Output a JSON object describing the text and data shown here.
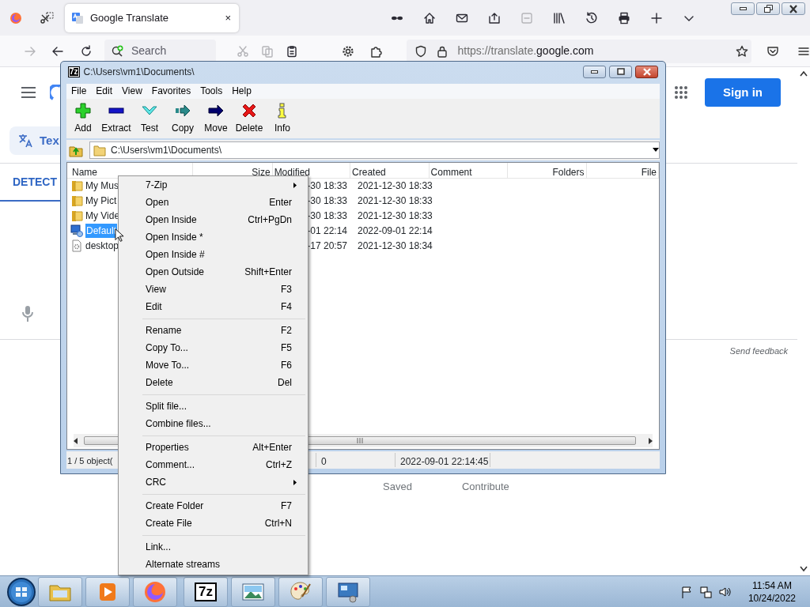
{
  "browser": {
    "tab_icons": [
      {
        "kind": "mask",
        "disabled": false
      },
      {
        "kind": "home",
        "disabled": false
      },
      {
        "kind": "mail",
        "disabled": false
      },
      {
        "kind": "share",
        "disabled": false
      },
      {
        "kind": "reader",
        "disabled": true
      },
      {
        "kind": "library",
        "disabled": false
      },
      {
        "kind": "history",
        "disabled": false
      },
      {
        "kind": "print",
        "disabled": false
      },
      {
        "kind": "plus",
        "disabled": false
      },
      {
        "kind": "chevron",
        "disabled": false
      }
    ],
    "tab": {
      "title": "Google Translate",
      "close": "×"
    },
    "nav_icons": [
      {
        "kind": "forward",
        "disabled": true
      },
      {
        "kind": "back",
        "disabled": false
      },
      {
        "kind": "reload",
        "disabled": false
      }
    ],
    "search_placeholder": "Search",
    "edit_icons": [
      {
        "kind": "cut",
        "disabled": true
      },
      {
        "kind": "copy",
        "disabled": true
      },
      {
        "kind": "paste",
        "disabled": false
      }
    ],
    "url": {
      "prefix": "https://translate.",
      "domain": "google.com"
    }
  },
  "page": {
    "sign_in": "Sign in",
    "text_chip": "Tex",
    "detect_tab": "DETECT",
    "send_feedback": "Send feedback",
    "bottom_links": [
      "Saved",
      "Contribute"
    ]
  },
  "zip_window": {
    "logo": "7z",
    "title": "C:\\Users\\vm1\\Documents\\",
    "menu": [
      "File",
      "Edit",
      "View",
      "Favorites",
      "Tools",
      "Help"
    ],
    "toolbar": [
      {
        "kind": "add",
        "label": "Add"
      },
      {
        "kind": "extract",
        "label": "Extract"
      },
      {
        "kind": "test",
        "label": "Test"
      },
      {
        "kind": "copy",
        "label": "Copy"
      },
      {
        "kind": "move",
        "label": "Move"
      },
      {
        "kind": "delete",
        "label": "Delete"
      },
      {
        "kind": "info",
        "label": "Info"
      }
    ],
    "path": "C:\\Users\\vm1\\Documents\\",
    "columns": [
      "Name",
      "Size",
      "Modified",
      "Created",
      "Comment",
      "Folders",
      "File"
    ],
    "rows": [
      {
        "kind": "folder",
        "name": "My Mus",
        "modified": "-30 18:33",
        "created": "2021-12-30 18:33",
        "selected": false
      },
      {
        "kind": "folder",
        "name": "My Pict",
        "modified": "-30 18:33",
        "created": "2021-12-30 18:33",
        "selected": false
      },
      {
        "kind": "folder",
        "name": "My Vide",
        "modified": "-30 18:33",
        "created": "2021-12-30 18:33",
        "selected": false
      },
      {
        "kind": "shortcut",
        "name": "Default",
        "modified": "-01 22:14",
        "created": "2022-09-01 22:14",
        "selected": true
      },
      {
        "kind": "settings",
        "name": "desktop",
        "modified": "-17 20:57",
        "created": "2021-12-30 18:34",
        "selected": false
      }
    ],
    "status": [
      "1 / 5 object(",
      "0",
      "2022-09-01 22:14:45"
    ]
  },
  "context_menu": [
    [
      {
        "label": "7-Zip",
        "submenu": true
      },
      {
        "label": "Open",
        "shortcut": "Enter"
      },
      {
        "label": "Open Inside",
        "shortcut": "Ctrl+PgDn"
      },
      {
        "label": "Open Inside *"
      },
      {
        "label": "Open Inside #"
      },
      {
        "label": "Open Outside",
        "shortcut": "Shift+Enter"
      },
      {
        "label": "View",
        "shortcut": "F3"
      },
      {
        "label": "Edit",
        "shortcut": "F4"
      }
    ],
    [
      {
        "label": "Rename",
        "shortcut": "F2"
      },
      {
        "label": "Copy To...",
        "shortcut": "F5"
      },
      {
        "label": "Move To...",
        "shortcut": "F6"
      },
      {
        "label": "Delete",
        "shortcut": "Del"
      }
    ],
    [
      {
        "label": "Split file..."
      },
      {
        "label": "Combine files..."
      }
    ],
    [
      {
        "label": "Properties",
        "shortcut": "Alt+Enter"
      },
      {
        "label": "Comment...",
        "shortcut": "Ctrl+Z"
      },
      {
        "label": "CRC",
        "submenu": true
      }
    ],
    [
      {
        "label": "Create Folder",
        "shortcut": "F7"
      },
      {
        "label": "Create File",
        "shortcut": "Ctrl+N"
      }
    ],
    [
      {
        "label": "Link..."
      },
      {
        "label": "Alternate streams"
      }
    ]
  ],
  "taskbar": {
    "apps": [
      {
        "kind": "explorer"
      },
      {
        "kind": "media"
      },
      {
        "kind": "firefox"
      },
      {
        "kind": "sevenzip",
        "label": "7z"
      },
      {
        "kind": "photos"
      },
      {
        "kind": "paint"
      },
      {
        "kind": "remote"
      }
    ],
    "tray": [
      {
        "kind": "flag"
      },
      {
        "kind": "network"
      },
      {
        "kind": "volume"
      }
    ],
    "time": "11:54 AM",
    "date": "10/24/2022"
  }
}
